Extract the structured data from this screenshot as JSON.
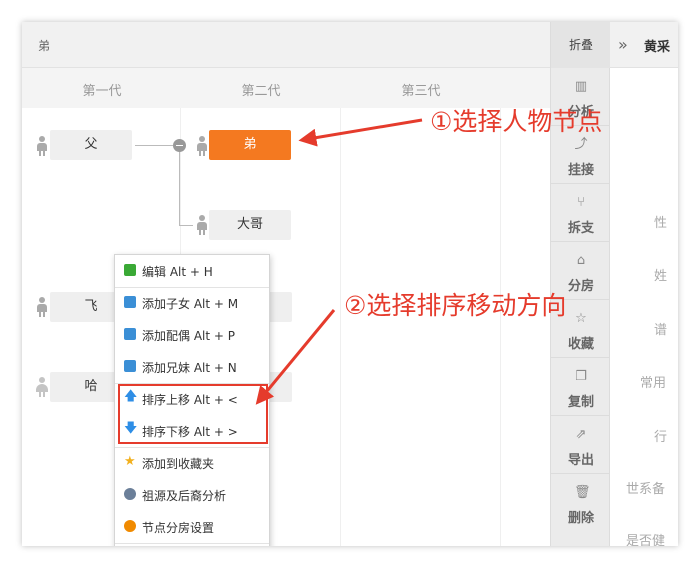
{
  "topbar": {
    "title": "弟"
  },
  "generations": [
    "第一代",
    "第二代",
    "第三代"
  ],
  "nodes": {
    "father": "父",
    "self": "弟",
    "elder_brother": "大哥",
    "fei": "飞",
    "ha": "哈"
  },
  "sidebar": {
    "collapse": "折叠",
    "items": [
      {
        "label": "分析",
        "icon": "bar-chart-icon"
      },
      {
        "label": "挂接",
        "icon": "link-curve-icon"
      },
      {
        "label": "拆支",
        "icon": "branch-icon"
      },
      {
        "label": "分房",
        "icon": "house-icon"
      },
      {
        "label": "收藏",
        "icon": "star-icon"
      },
      {
        "label": "复制",
        "icon": "copy-icon"
      },
      {
        "label": "导出",
        "icon": "export-icon"
      },
      {
        "label": "删除",
        "icon": "trash-icon"
      }
    ]
  },
  "right_panel": {
    "name": "黄采",
    "labels": [
      "性",
      "姓",
      "谱",
      "常用",
      "行",
      "世系备",
      "是否健"
    ]
  },
  "context_menu": {
    "items": [
      {
        "label": "编辑 Alt + H",
        "icon": "edit-icon",
        "color": "#3aa935"
      },
      {
        "label": "添加子女 Alt + M",
        "icon": "add-children-icon",
        "color": "#3b8fd6"
      },
      {
        "label": "添加配偶 Alt + P",
        "icon": "add-spouse-icon",
        "color": "#3b8fd6"
      },
      {
        "label": "添加兄妹 Alt + N",
        "icon": "add-sibling-icon",
        "color": "#3b8fd6"
      },
      {
        "label": "排序上移 Alt + <",
        "icon": "arrow-up-icon",
        "color": "#2e8ee6"
      },
      {
        "label": "排序下移 Alt + >",
        "icon": "arrow-down-icon",
        "color": "#2e8ee6"
      },
      {
        "label": "添加到收藏夹",
        "icon": "star-icon",
        "color": "#f2b01e"
      },
      {
        "label": "祖源及后裔分析",
        "icon": "lineage-icon",
        "color": "#6b7f99"
      },
      {
        "label": "节点分房设置",
        "icon": "warning-icon",
        "color": "#f08a00"
      }
    ]
  },
  "annotations": {
    "step1": "①选择人物节点",
    "step2": "②选择排序移动方向"
  },
  "colors": {
    "accent": "#f47920",
    "annotation": "#e53b2c"
  }
}
